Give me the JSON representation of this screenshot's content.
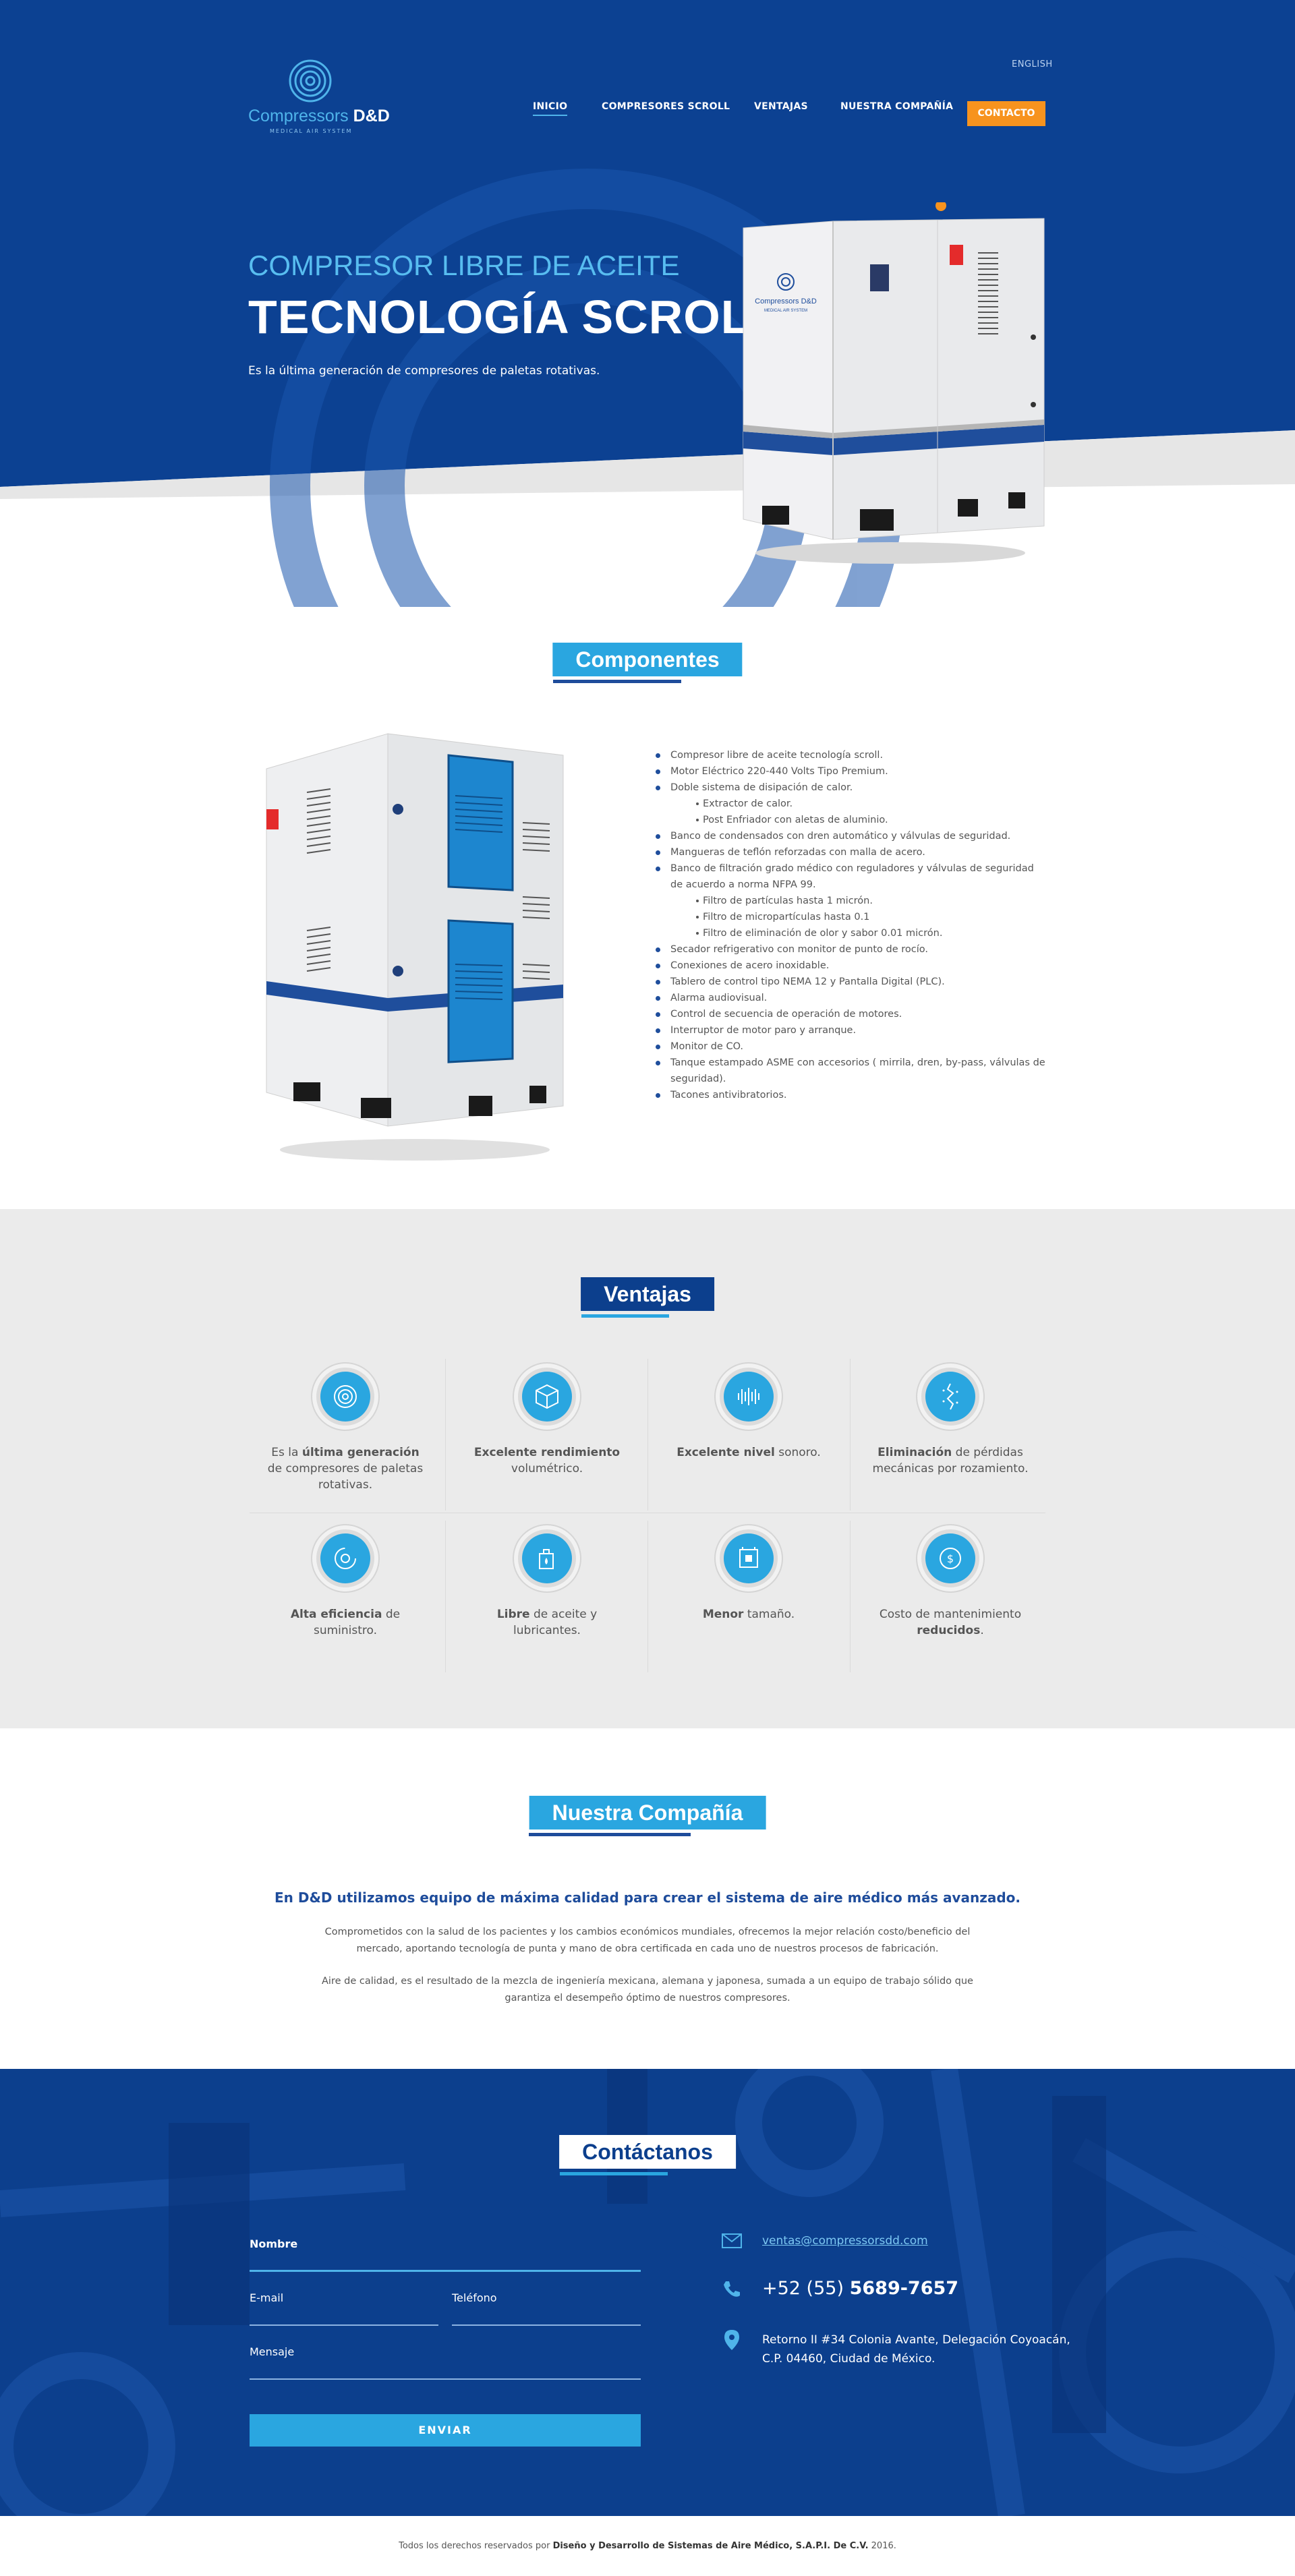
{
  "header": {
    "language": "ENGLISH",
    "logo_brand": "Compressors",
    "logo_brand_bold": "D&D",
    "logo_tagline": "MEDICAL AIR SYSTEM",
    "nav": [
      "INICIO",
      "COMPRESORES SCROLL",
      "VENTAJAS",
      "NUESTRA COMPAÑÍA"
    ],
    "contact_button": "CONTACTO"
  },
  "hero": {
    "subtitle": "COMPRESOR LIBRE DE ACEITE",
    "title": "TECNOLOGÍA SCROLL",
    "description": "Es la última generación de compresores de paletas rotativas.",
    "product_label": "Compressors D&D",
    "product_sublabel": "MEDICAL AIR SYSTEM"
  },
  "components": {
    "title": "Componentes",
    "items": [
      {
        "text": "Compresor libre de aceite tecnología scroll.",
        "sub": false
      },
      {
        "text": "Motor Eléctrico 220-440 Volts Tipo Premium.",
        "sub": false
      },
      {
        "text": "Doble sistema de disipación de calor.",
        "sub": false
      },
      {
        "text": "Extractor de calor.",
        "sub": true
      },
      {
        "text": "Post Enfriador con aletas de aluminio.",
        "sub": true
      },
      {
        "text": "Banco de condensados con dren automático y válvulas de seguridad.",
        "sub": false
      },
      {
        "text": "Mangueras de teflón reforzadas con malla de acero.",
        "sub": false
      },
      {
        "text": "Banco de filtración grado médico con reguladores y válvulas de seguridad de acuerdo a norma NFPA 99.",
        "sub": false
      },
      {
        "text": "Filtro de partículas hasta 1 micrón.",
        "sub": true
      },
      {
        "text": "Filtro de micropartículas hasta 0.1",
        "sub": true
      },
      {
        "text": "Filtro de eliminación de olor y sabor 0.01 micrón.",
        "sub": true
      },
      {
        "text": "Secador refrigerativo con monitor de punto de rocío.",
        "sub": false
      },
      {
        "text": "Conexiones de acero inoxidable.",
        "sub": false
      },
      {
        "text": "Tablero de control tipo NEMA 12 y Pantalla Digital (PLC).",
        "sub": false
      },
      {
        "text": "Alarma audiovisual.",
        "sub": false
      },
      {
        "text": "Control de secuencia de operación de motores.",
        "sub": false
      },
      {
        "text": "Interruptor de motor paro y arranque.",
        "sub": false
      },
      {
        "text": "Monitor de CO.",
        "sub": false
      },
      {
        "text": "Tanque estampado ASME con accesorios ( mirrila, dren, by-pass, válvulas de seguridad).",
        "sub": false
      },
      {
        "text": "Tacones antivibratorios.",
        "sub": false
      }
    ]
  },
  "ventajas": {
    "title": "Ventajas",
    "items": [
      {
        "icon": "spiral-icon",
        "pre": "Es la ",
        "bold": "última generación",
        "post": " de compresores de paletas rotativas."
      },
      {
        "icon": "cube-icon",
        "pre": "",
        "bold": "Excelente rendimiento",
        "post": " volumétrico."
      },
      {
        "icon": "sound-wave-icon",
        "pre": "",
        "bold": "Excelente nivel",
        "post": " sonoro."
      },
      {
        "icon": "vibration-icon",
        "pre": "",
        "bold": "Eliminación",
        "post": " de pérdidas mecánicas por rozamiento."
      },
      {
        "icon": "efficiency-icon",
        "pre": "",
        "bold": "Alta eficiencia",
        "post": " de suministro."
      },
      {
        "icon": "oil-can-icon",
        "pre": "",
        "bold": "Libre",
        "post": " de aceite y lubricantes."
      },
      {
        "icon": "small-size-icon",
        "pre": "",
        "bold": "Menor",
        "post": " tamaño."
      },
      {
        "icon": "money-icon",
        "pre": "Costo de mantenimiento ",
        "bold": "reducidos",
        "post": "."
      }
    ]
  },
  "company": {
    "title": "Nuestra Compañía",
    "lead": "En D&D utilizamos equipo de máxima calidad  para crear el sistema de aire médico más avanzado.",
    "p1": "Comprometidos con la salud de los pacientes y los cambios  económicos mundiales, ofrecemos la mejor relación costo/beneficio del mercado, aportando tecnología de punta y mano de obra certificada en cada uno de nuestros procesos de fabricación.",
    "p2": "Aire de calidad, es el resultado de la mezcla de ingeniería mexicana, alemana y japonesa, sumada a un equipo de trabajo sólido que garantiza el desempeño óptimo de nuestros compresores."
  },
  "contact": {
    "title": "Contáctanos",
    "fields": {
      "name": "Nombre",
      "email": "E-mail",
      "phone": "Teléfono",
      "message": "Mensaje"
    },
    "send": "ENVIAR",
    "email": "ventas@compressorsdd.com",
    "phone_prefix": "+52 (55) ",
    "phone_number": "5689-7657",
    "address_line1": "Retorno II #34 Colonia Avante, Delegación Coyoacán,",
    "address_line2": "C.P. 04460, Ciudad de México."
  },
  "footer": {
    "pre": "Todos los derechos reservados por ",
    "bold": "Diseño y Desarrollo de Sistemas de Aire Médico, S.A.P.I. De C.V.",
    "post": " 2016."
  },
  "colors": {
    "primary_blue": "#0c3f8d",
    "accent_cyan": "#2aa6e0",
    "orange": "#f7931e",
    "light_gray": "#ebebeb"
  }
}
